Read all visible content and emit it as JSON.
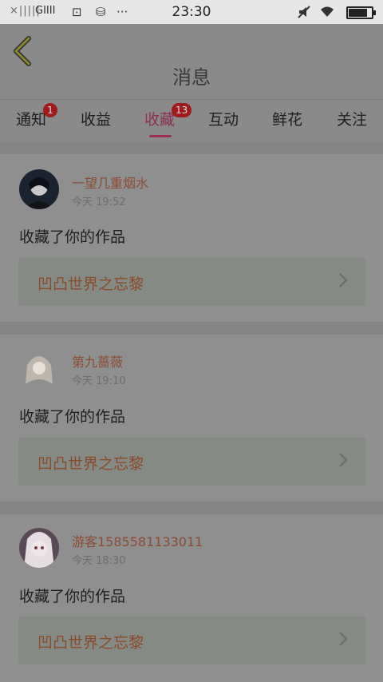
{
  "status_bar": {
    "signal_text": "×|||||",
    "carrier_text": "GIIII",
    "time": "23:30",
    "battery_fraction": 0.9
  },
  "header": {
    "back_icon": "chevron-left-icon",
    "title": "消息"
  },
  "tabs": [
    {
      "label": "通知",
      "badge": "1"
    },
    {
      "label": "收益",
      "badge": ""
    },
    {
      "label": "收藏",
      "badge": "13",
      "active": true
    },
    {
      "label": "互动",
      "badge": ""
    },
    {
      "label": "鲜花",
      "badge": ""
    },
    {
      "label": "关注",
      "badge": ""
    }
  ],
  "feed": [
    {
      "user": "一望几重烟水",
      "time": "今天 19:52",
      "action": "收藏了你的作品",
      "work_title": "凹凸世界之忘黎"
    },
    {
      "user": "第九蔷薇",
      "time": "今天 19:10",
      "action": "收藏了你的作品",
      "work_title": "凹凸世界之忘黎"
    },
    {
      "user": "游客1585581133011",
      "time": "今天 18:30",
      "action": "收藏了你的作品",
      "work_title": "凹凸世界之忘黎"
    }
  ],
  "colors": {
    "accent": "#9d2d57",
    "username": "#8a4c34",
    "badge": "#a01b1b"
  }
}
